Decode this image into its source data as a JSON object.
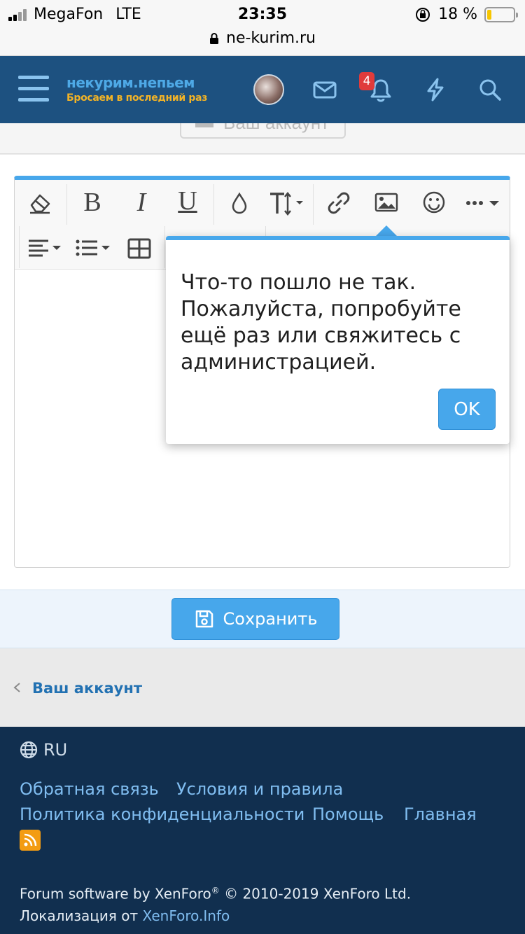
{
  "status_bar": {
    "carrier": "MegaFon",
    "network": "LTE",
    "time": "23:35",
    "battery": "18 %",
    "battery_level": 0.18,
    "url": "ne-kurim.ru"
  },
  "header": {
    "logo_title": "некурим.непьем",
    "logo_subtitle": "Бросаем в последний раз",
    "notification_count": "4",
    "colors": {
      "bar": "#1d5180",
      "accent": "#47a7eb"
    }
  },
  "account_button": {
    "label": "Ваш аккаунт"
  },
  "editor": {
    "toolbar": {
      "bold": "B",
      "italic": "I",
      "underline": "U"
    }
  },
  "dialog": {
    "message": "Что-то пошло не так. Пожалуйста, попробуйте ещё раз или свяжитесь с администрацией.",
    "ok_label": "OK"
  },
  "save_button": {
    "label": "Сохранить"
  },
  "breadcrumb": {
    "label": "Ваш аккаунт"
  },
  "footer": {
    "language": "RU",
    "links": [
      "Обратная связь",
      "Условия и правила",
      "Политика конфиденциальности",
      "Помощь",
      "Главная"
    ],
    "software_text": "Forum software by XenForo",
    "registered_mark": "®",
    "copyright_text": " © 2010-2019 XenForo Ltd.",
    "localization_text": "Локализация от ",
    "localization_link": "XenForo.Info"
  }
}
